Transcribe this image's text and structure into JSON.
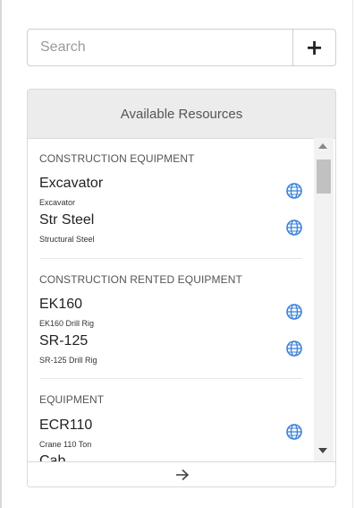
{
  "search": {
    "placeholder": "Search",
    "add_label": "+"
  },
  "panel": {
    "title": "Available Resources",
    "sections": [
      {
        "title": "CONSTRUCTION EQUIPMENT",
        "items": [
          {
            "name": "Excavator",
            "subtitle": "Excavator"
          },
          {
            "name": "Str Steel",
            "subtitle": "Structural Steel"
          }
        ]
      },
      {
        "title": "CONSTRUCTION RENTED EQUIPMENT",
        "items": [
          {
            "name": "EK160",
            "subtitle": "EK160 Drill Rig"
          },
          {
            "name": "SR-125",
            "subtitle": "SR-125 Drill Rig"
          }
        ]
      },
      {
        "title": "EQUIPMENT",
        "items": [
          {
            "name": "ECR110",
            "subtitle": "Crane 110 Ton"
          },
          {
            "name": "Cab",
            "subtitle": ""
          }
        ]
      }
    ],
    "footer_icon": "arrow-right-icon",
    "item_icon": "globe-icon",
    "accent_color": "#3b82d9"
  }
}
